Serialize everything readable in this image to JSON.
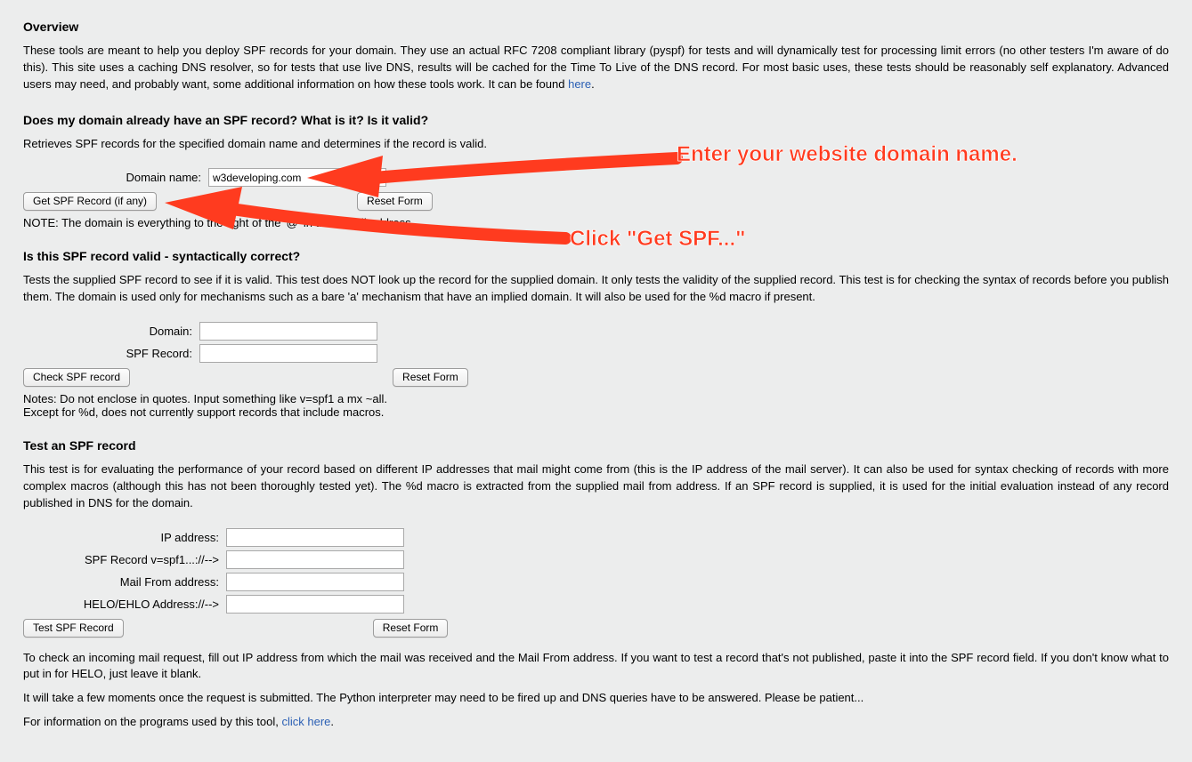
{
  "overview": {
    "heading": "Overview",
    "para_pre": "These tools are meant to help you deploy SPF records for your domain. They use an actual RFC 7208 compliant library (pyspf) for tests and will dynamically test for processing limit errors (no other testers I'm aware of do this). This site uses a caching DNS resolver, so for tests that use live DNS, results will be cached for the Time To Live of the DNS record. For most basic uses, these tests should be reasonably self explanatory. Advanced users may need, and probably want, some additional information on how these tools work. It can be found ",
    "here": "here",
    "dot": "."
  },
  "sec1": {
    "heading": "Does my domain already have an SPF record? What is it? Is it valid?",
    "desc": "Retrieves SPF records for the specified domain name and determines if the record is valid.",
    "domain_label": "Domain name:",
    "domain_value": "w3developing.com",
    "get_btn": "Get SPF Record (if any)",
    "reset_btn": "Reset Form",
    "note": "NOTE: The domain is everything to the right of the '@' in the e-mail address."
  },
  "sec2": {
    "heading": "Is this SPF record valid - syntactically correct?",
    "desc": "Tests the supplied SPF record to see if it is valid. This test does NOT look up the record for the supplied domain. It only tests the validity of the supplied record. This test is for checking the syntax of records before you publish them. The domain is used only for mechanisms such as a bare 'a' mechanism that have an implied domain. It will also be used for the %d macro if present.",
    "domain_label": "Domain:",
    "spf_label": "SPF Record:",
    "check_btn": "Check SPF record",
    "reset_btn": "Reset Form",
    "note1": "Notes: Do not enclose in quotes. Input something like v=spf1 a mx ~all.",
    "note2": "Except for %d, does not currently support records that include macros."
  },
  "sec3": {
    "heading": "Test an SPF record",
    "desc": "This test is for evaluating the performance of your record based on different IP addresses that mail might come from (this is the IP address of the mail server). It can also be used for syntax checking of records with more complex macros (although this has not been thoroughly tested yet). The %d macro is extracted from the supplied mail from address. If an SPF record is supplied, it is used for the initial evaluation instead of any record published in DNS for the domain.",
    "ip_label": "IP address:",
    "spf_label": "SPF Record v=spf1...://-->",
    "mailfrom_label": "Mail From address:",
    "helo_label": "HELO/EHLO Address://-->",
    "test_btn": "Test SPF Record",
    "reset_btn": "Reset Form",
    "after1": "To check an incoming mail request, fill out IP address from which the mail was received and the Mail From address. If you want to test a record that's not published, paste it into the SPF record field. If you don't know what to put in for HELO, just leave it blank.",
    "after2": "It will take a few moments once the request is submitted. The Python interpreter may need to be fired up and DNS queries have to be answered. Please be patient...",
    "after3_pre": "For information on the programs used by this tool, ",
    "click_here": "click here",
    "after3_post": "."
  },
  "annot": {
    "a1": "Enter your website domain name.",
    "a2": "Click \"Get SPF...\""
  }
}
